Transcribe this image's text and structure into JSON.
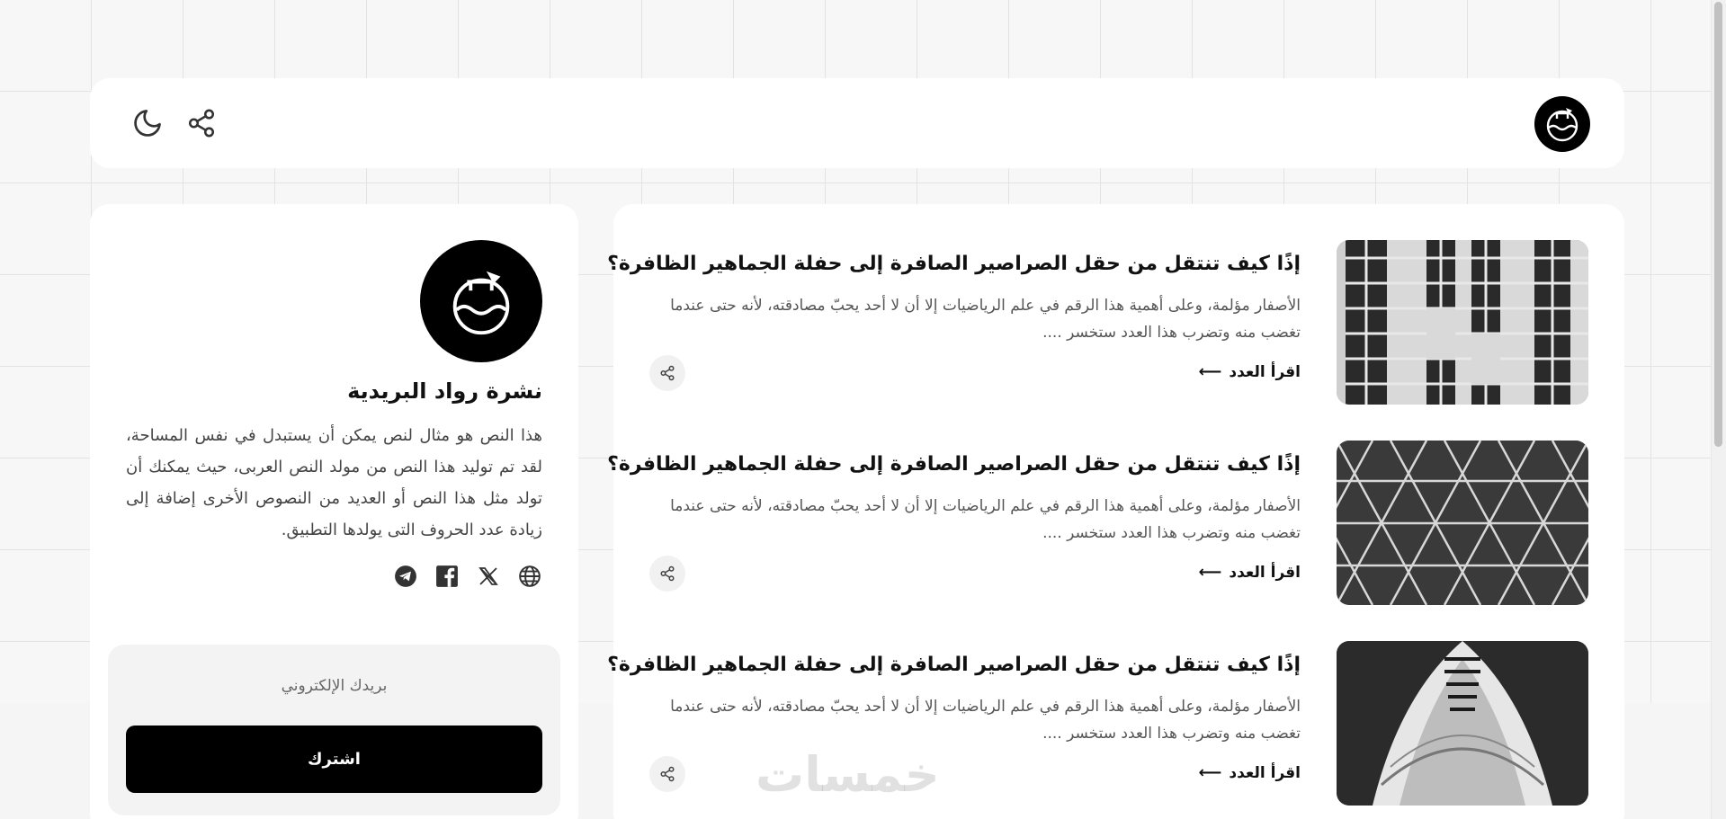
{
  "header": {
    "logo_icon": "flask-icon",
    "share_icon": "share-icon",
    "theme_icon": "moon-icon"
  },
  "articles": [
    {
      "title": "إذًا كيف تنتقل من حقل الصراصير الصافرة إلى حفلة الجماهير الظافرة؟",
      "excerpt": "الأصفار مؤلمة، وعلى أهمية هذا الرقم في علم الرياضيات إلا أن لا أحد يحبّ مصادقته، لأنه حتى عندما تغضب منه وتضرب هذا العدد ستخسر ....",
      "read_label": "اقرأ العدد",
      "image": "building-windows"
    },
    {
      "title": "إذًا كيف تنتقل من حقل الصراصير الصافرة إلى حفلة الجماهير الظافرة؟",
      "excerpt": "الأصفار مؤلمة، وعلى أهمية هذا الرقم في علم الرياضيات إلا أن لا أحد يحبّ مصادقته، لأنه حتى عندما تغضب منه وتضرب هذا العدد ستخسر ....",
      "read_label": "اقرأ العدد",
      "image": "geometric-pattern"
    },
    {
      "title": "إذًا كيف تنتقل من حقل الصراصير الصافرة إلى حفلة الجماهير الظافرة؟",
      "excerpt": "الأصفار مؤلمة، وعلى أهمية هذا الرقم في علم الرياضيات إلا أن لا أحد يحبّ مصادقته، لأنه حتى عندما تغضب منه وتضرب هذا العدد ستخسر ....",
      "read_label": "اقرأ العدد",
      "image": "boat-bow"
    }
  ],
  "sidebar": {
    "title": "نشرة رواد البريدية",
    "description": "هذا النص هو مثال لنص يمكن أن يستبدل في نفس المساحة، لقد تم توليد هذا النص من مولد النص العربى، حيث يمكنك أن تولد مثل هذا النص أو العديد من النصوص الأخرى إضافة إلى زيادة عدد الحروف التى يولدها التطبيق.",
    "social_icons": [
      "globe-icon",
      "x-icon",
      "facebook-icon",
      "telegram-icon"
    ],
    "email_placeholder": "بريدك الإلكتروني",
    "subscribe_label": "اشترك"
  },
  "watermark": "خمسات",
  "colors": {
    "accent": "#000000",
    "card": "#ffffff",
    "muted_text": "#555555"
  }
}
